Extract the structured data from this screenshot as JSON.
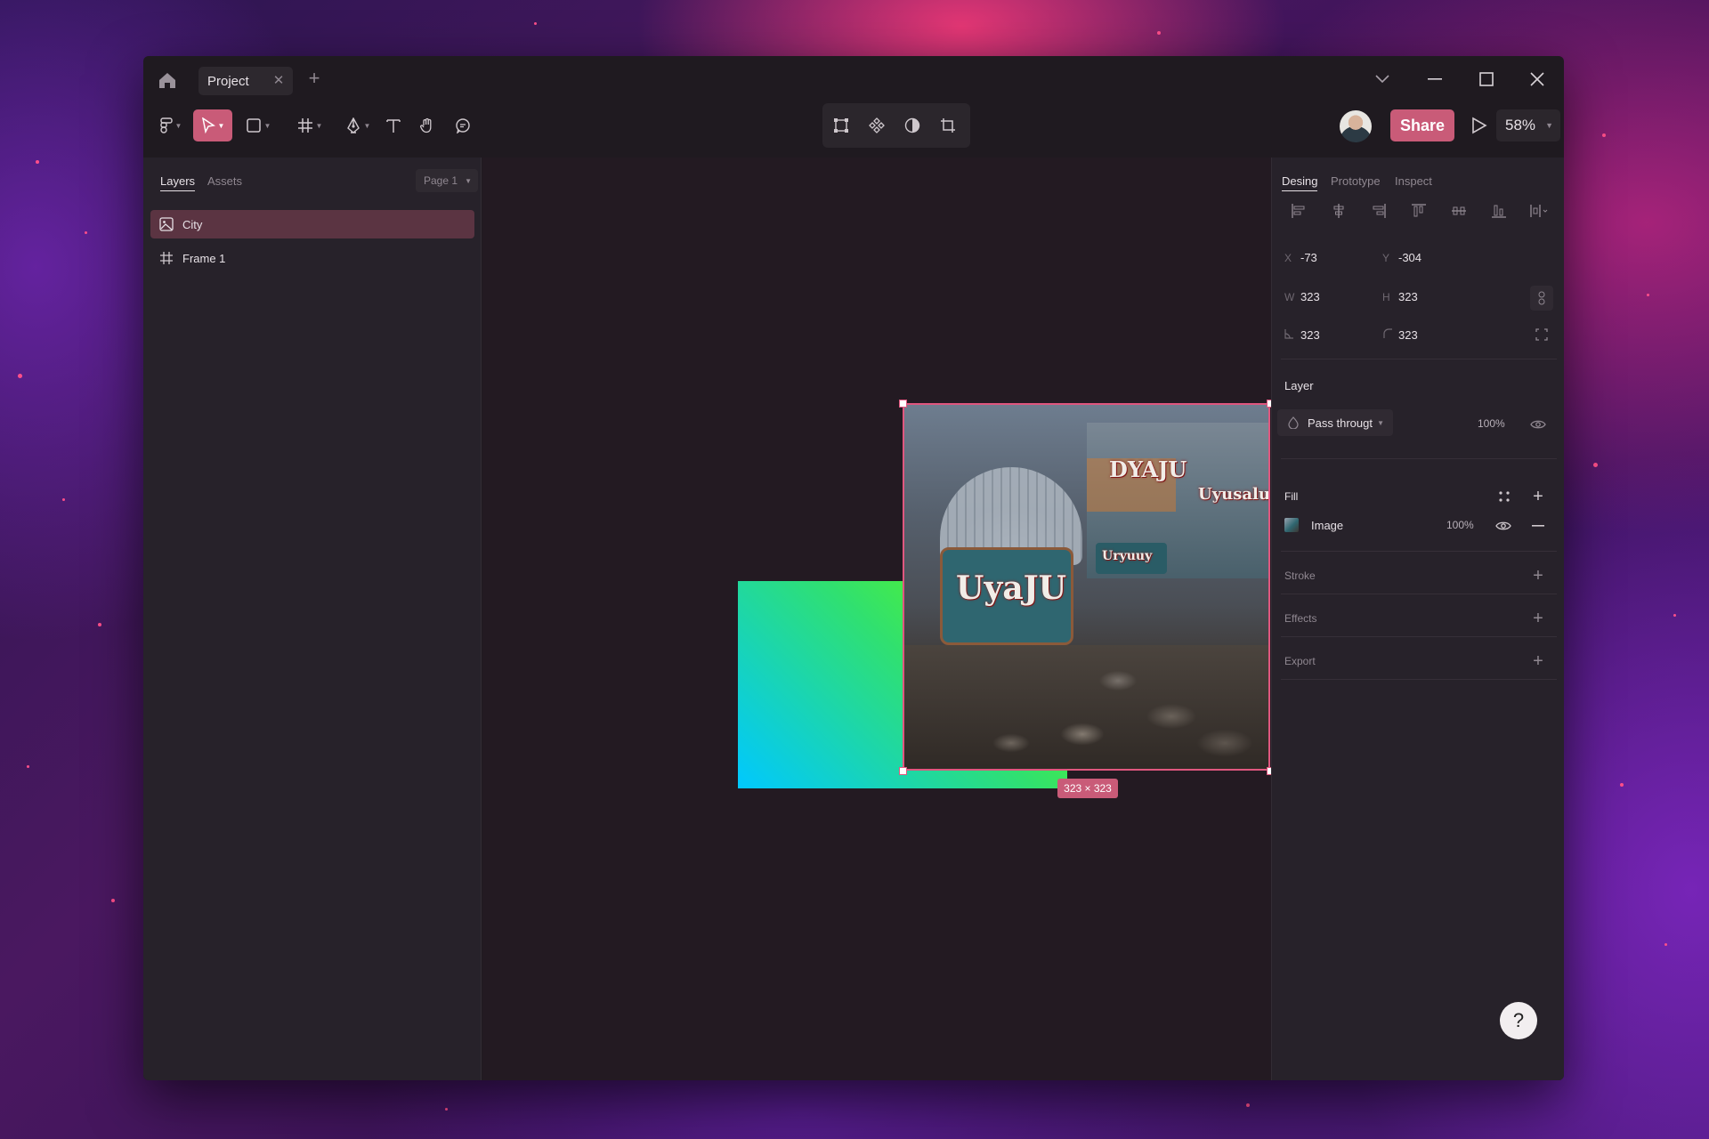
{
  "titlebar": {
    "tab_label": "Project"
  },
  "toolbar": {
    "share_label": "Share",
    "zoom_level": "58%"
  },
  "left_panel": {
    "tabs": [
      "Layers",
      "Assets"
    ],
    "page_select": "Page 1",
    "layers": [
      {
        "name": "City",
        "icon": "image-icon",
        "selected": true
      },
      {
        "name": "Frame 1",
        "icon": "frame-icon",
        "selected": false
      }
    ]
  },
  "canvas": {
    "size_badge": "323 × 323",
    "image_signs": [
      "DYAJU",
      "Uyusalu",
      "UyaJU",
      "Uryuuy"
    ]
  },
  "right_panel": {
    "tabs": [
      "Desing",
      "Prototype",
      "Inspect"
    ],
    "position": {
      "x_label": "X",
      "x": "-73",
      "y_label": "Y",
      "y": "-304"
    },
    "size": {
      "w_label": "W",
      "w": "323",
      "h_label": "H",
      "h": "323"
    },
    "extra": {
      "a": "323",
      "b": "323"
    },
    "layer": {
      "title": "Layer",
      "blend": "Pass througt",
      "opacity": "100%"
    },
    "fill": {
      "title": "Fill",
      "type": "Image",
      "opacity": "100%"
    },
    "stroke": {
      "title": "Stroke"
    },
    "effects": {
      "title": "Effects"
    },
    "export": {
      "title": "Export"
    }
  },
  "help_label": "?",
  "colors": {
    "accent": "#c95b78",
    "selection": "#e0577f",
    "panel": "#27222a",
    "canvas": "#231a22"
  }
}
